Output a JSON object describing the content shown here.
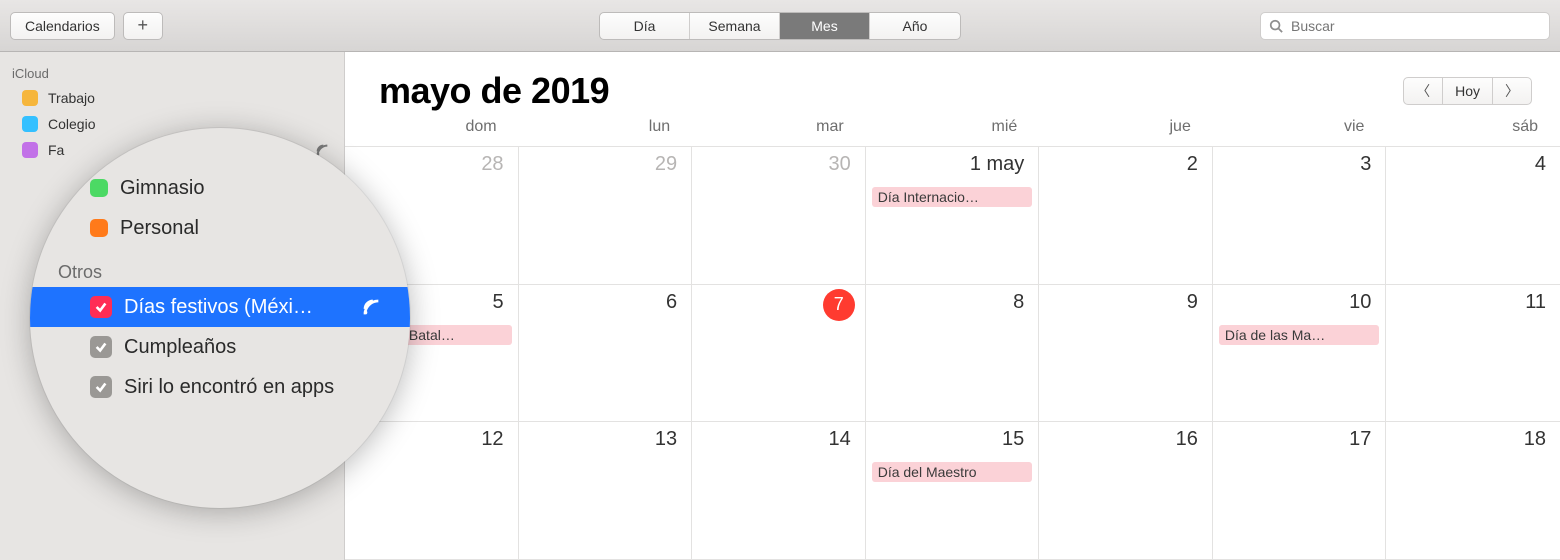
{
  "toolbar": {
    "calendars_label": "Calendarios",
    "add_label": "+",
    "view_segments": {
      "day": "Día",
      "week": "Semana",
      "month": "Mes",
      "year": "Año",
      "active": "month"
    },
    "search_placeholder": "Buscar"
  },
  "sidebar": {
    "sections": [
      {
        "title": "iCloud",
        "items": [
          {
            "label": "Trabajo",
            "color": "#f6b63c"
          },
          {
            "label": "Colegio",
            "color": "#34c0ff"
          },
          {
            "label": "Fa",
            "color": "#c271e8",
            "broadcast": true
          }
        ]
      }
    ]
  },
  "lens": {
    "top_items": [
      {
        "label": "Gimnasio",
        "color": "#4cd964"
      },
      {
        "label": "Personal",
        "color": "#ff7a1a"
      }
    ],
    "section_title": "Otros",
    "items": [
      {
        "label": "Días festivos (Méxi…",
        "selected": true,
        "check_color": "#ff2d55",
        "broadcast": true
      },
      {
        "label": "Cumpleaños",
        "selected": false
      },
      {
        "label": "Siri lo encontró en apps",
        "selected": false
      }
    ]
  },
  "main": {
    "title": "mayo de 2019",
    "today_label": "Hoy",
    "dow": [
      "dom",
      "lun",
      "mar",
      "mié",
      "jue",
      "vie",
      "sáb"
    ],
    "rows": [
      [
        {
          "n": "28",
          "dim": true
        },
        {
          "n": "29",
          "dim": true
        },
        {
          "n": "30",
          "dim": true
        },
        {
          "n": "1 may",
          "event": "Día Internacio…"
        },
        {
          "n": "2"
        },
        {
          "n": "3"
        },
        {
          "n": "4"
        }
      ],
      [
        {
          "n": "5",
          "event": "Día de la Batal…",
          "clipleft": true
        },
        {
          "n": "6"
        },
        {
          "n": "7",
          "today": true
        },
        {
          "n": "8"
        },
        {
          "n": "9"
        },
        {
          "n": "10",
          "event": "Día de las Ma…"
        },
        {
          "n": "11"
        }
      ],
      [
        {
          "n": "12"
        },
        {
          "n": "13"
        },
        {
          "n": "14"
        },
        {
          "n": "15",
          "event": "Día del Maestro"
        },
        {
          "n": "16"
        },
        {
          "n": "17"
        },
        {
          "n": "18"
        }
      ]
    ]
  }
}
